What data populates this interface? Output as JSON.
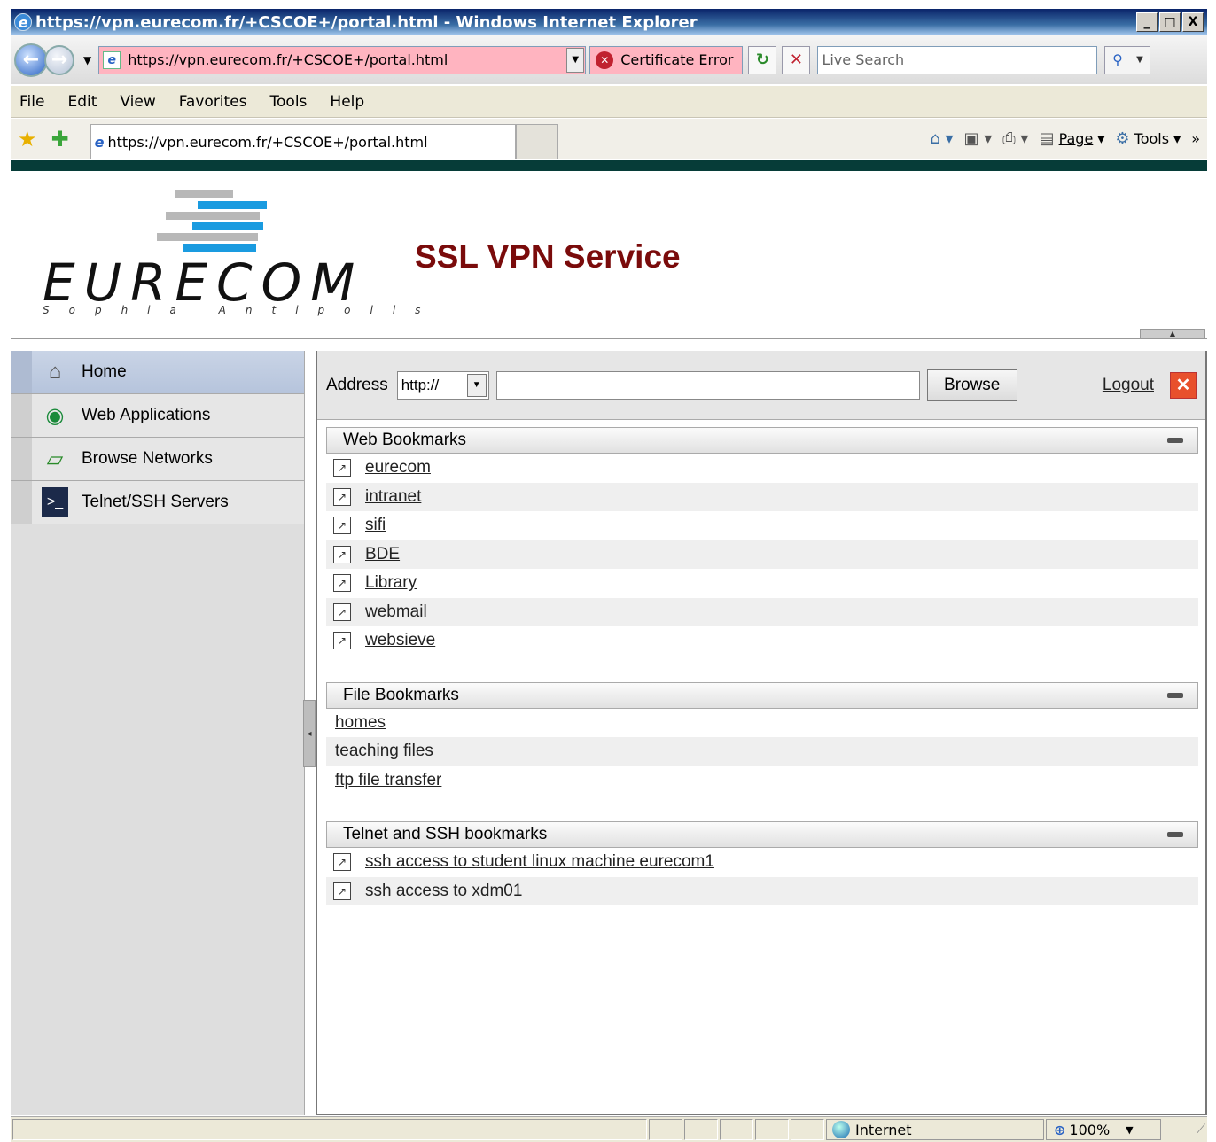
{
  "window": {
    "title": "https://vpn.eurecom.fr/+CSCOE+/portal.html - Windows Internet Explorer",
    "minimize": "_",
    "maximize": "□",
    "close": "X"
  },
  "navbar": {
    "address": "https://vpn.eurecom.fr/+CSCOE+/portal.html",
    "cert_error": "Certificate Error",
    "search_placeholder": "Live Search"
  },
  "menu": [
    "File",
    "Edit",
    "View",
    "Favorites",
    "Tools",
    "Help"
  ],
  "favbar": {
    "tab_title": "https://vpn.eurecom.fr/+CSCOE+/portal.html",
    "page_label": "Page",
    "tools_label": "Tools"
  },
  "header": {
    "logo_name": "EURECOM",
    "logo_sub": "Sophia Antipolis",
    "title": "SSL VPN Service"
  },
  "sidebar": {
    "items": [
      {
        "label": "Home",
        "icon": "home-icon"
      },
      {
        "label": "Web Applications",
        "icon": "web-applications-icon"
      },
      {
        "label": "Browse Networks",
        "icon": "browse-networks-icon"
      },
      {
        "label": "Telnet/SSH Servers",
        "icon": "terminal-icon"
      }
    ]
  },
  "main": {
    "address_label": "Address",
    "protocol": "http://",
    "url_value": "",
    "browse_label": "Browse",
    "logout_label": "Logout"
  },
  "web_bookmarks": {
    "title": "Web Bookmarks",
    "items": [
      "eurecom",
      "intranet",
      "sifi",
      "BDE",
      "Library",
      "webmail",
      "websieve"
    ]
  },
  "file_bookmarks": {
    "title": "File Bookmarks",
    "items": [
      "homes",
      "teaching files",
      "ftp file transfer"
    ]
  },
  "ssh_bookmarks": {
    "title": "Telnet and SSH bookmarks",
    "items": [
      "ssh access to student linux machine eurecom1",
      "ssh access to xdm01"
    ]
  },
  "statusbar": {
    "zone": "Internet",
    "zoom": "100%"
  },
  "colors": {
    "title_red": "#7a0b0b",
    "header_strip": "#063c38",
    "cert_error_bg": "#ffb4c0",
    "logo_gray": "#b8b8b8",
    "logo_blue": "#1a9be0"
  }
}
